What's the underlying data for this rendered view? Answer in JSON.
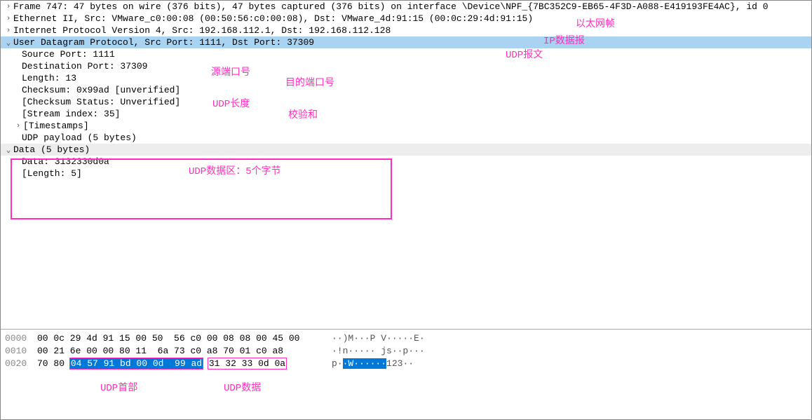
{
  "packet": {
    "frame": "Frame 747: 47 bytes on wire (376 bits), 47 bytes captured (376 bits) on interface \\Device\\NPF_{7BC352C9-EB65-4F3D-A088-E419193FE4AC}, id 0",
    "eth": "Ethernet II, Src: VMware_c0:00:08 (00:50:56:c0:00:08), Dst: VMware_4d:91:15 (00:0c:29:4d:91:15)",
    "ip": "Internet Protocol Version 4, Src: 192.168.112.1, Dst: 192.168.112.128",
    "udp": "User Datagram Protocol, Src Port: 1111, Dst Port: 37309",
    "udp_src": "Source Port: 1111",
    "udp_dst": "Destination Port: 37309",
    "udp_len": "Length: 13",
    "udp_cksum": "Checksum: 0x99ad [unverified]",
    "udp_cksum_status": "[Checksum Status: Unverified]",
    "udp_stream": "[Stream index: 35]",
    "udp_ts": "[Timestamps]",
    "udp_payload": "UDP payload (5 bytes)",
    "data_hdr": "Data (5 bytes)",
    "data_val": "Data: 3132330d0a",
    "data_len": "[Length: 5]"
  },
  "annotations": {
    "eth": "以太网帧",
    "ip": "IP数据报",
    "udp": "UDP报文",
    "src_port": "源端口号",
    "dst_port": "目的端口号",
    "udp_len": "UDP长度",
    "checksum": "校验和",
    "payload": "UDP数据区：5个字节",
    "udp_header": "UDP首部",
    "udp_data": "UDP数据"
  },
  "hex": {
    "r0_off": "0000",
    "r0_b1": "00 0c 29 4d 91 15 00 50",
    "r0_b2": "56 c0 00 08 08 00 45 00",
    "r0_a": "··)M···P V·····E·",
    "r1_off": "0010",
    "r1_b1": "00 21 6e 00 00 80 11",
    "r1_b2": "6a 73 c0 a8 70 01 c0 a8",
    "r1_a": "·!n····· js··p···",
    "r2_off": "0020",
    "r2_p0": "70 80 ",
    "r2_p1": "04 57 91 bd 00 0d  99 ad",
    "r2_p2": " ",
    "r2_p3": "31 32 33 0d 0a",
    "r2_a0": "p·",
    "r2_a1": "·W······",
    "r2_a2": "123",
    "r2_a3": "··"
  }
}
